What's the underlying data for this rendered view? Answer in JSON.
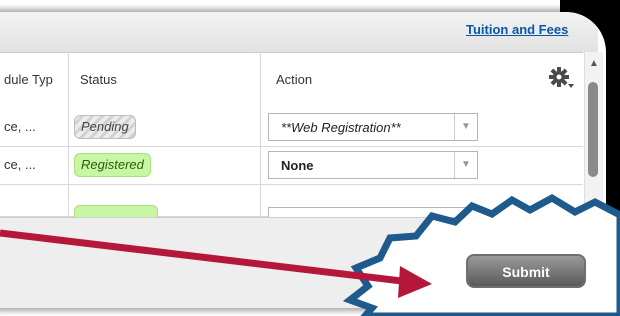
{
  "top_link": "Tuition and Fees",
  "columns": {
    "schedule_type": "dule Typ",
    "status": "Status",
    "action": "Action"
  },
  "rows": [
    {
      "schedule_type": "ce, ...",
      "status": "Pending",
      "action": "**Web Registration**"
    },
    {
      "schedule_type": "ce, ...",
      "status": "Registered",
      "action": "None"
    }
  ],
  "submit_label": "Submit",
  "colors": {
    "link": "#0a57a8",
    "pending_bg": "#d2d2d2",
    "registered_bg": "#c8f7a4",
    "arrow": "#b5173a",
    "starburst": "#1e5a8c"
  },
  "icons": [
    "gear-icon",
    "chevron-down-icon",
    "scroll-up-icon",
    "scroll-down-icon",
    "arrow-annotation",
    "starburst-annotation"
  ]
}
